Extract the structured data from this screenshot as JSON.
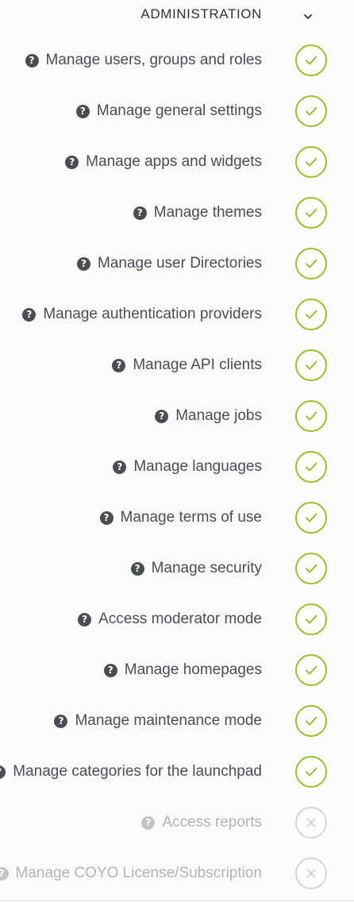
{
  "section": {
    "title": "ADMINISTRATION",
    "toggle_icon": "chevron-down-icon"
  },
  "colors": {
    "granted": "#9bbd2a",
    "denied": "#d4d5d7",
    "label": "#4a4d52",
    "label_disabled": "#b2b4b7"
  },
  "permissions": [
    {
      "label": "Manage users, groups and roles",
      "granted": true
    },
    {
      "label": "Manage general settings",
      "granted": true
    },
    {
      "label": "Manage apps and widgets",
      "granted": true
    },
    {
      "label": "Manage themes",
      "granted": true
    },
    {
      "label": "Manage user Directories",
      "granted": true
    },
    {
      "label": "Manage authentication providers",
      "granted": true
    },
    {
      "label": "Manage API clients",
      "granted": true
    },
    {
      "label": "Manage jobs",
      "granted": true
    },
    {
      "label": "Manage languages",
      "granted": true
    },
    {
      "label": "Manage terms of use",
      "granted": true
    },
    {
      "label": "Manage security",
      "granted": true
    },
    {
      "label": "Access moderator mode",
      "granted": true
    },
    {
      "label": "Manage homepages",
      "granted": true
    },
    {
      "label": "Manage maintenance mode",
      "granted": true
    },
    {
      "label": "Manage categories for the launchpad",
      "granted": true
    },
    {
      "label": "Access reports",
      "granted": false
    },
    {
      "label": "Manage COYO License/Subscription",
      "granted": false
    }
  ]
}
